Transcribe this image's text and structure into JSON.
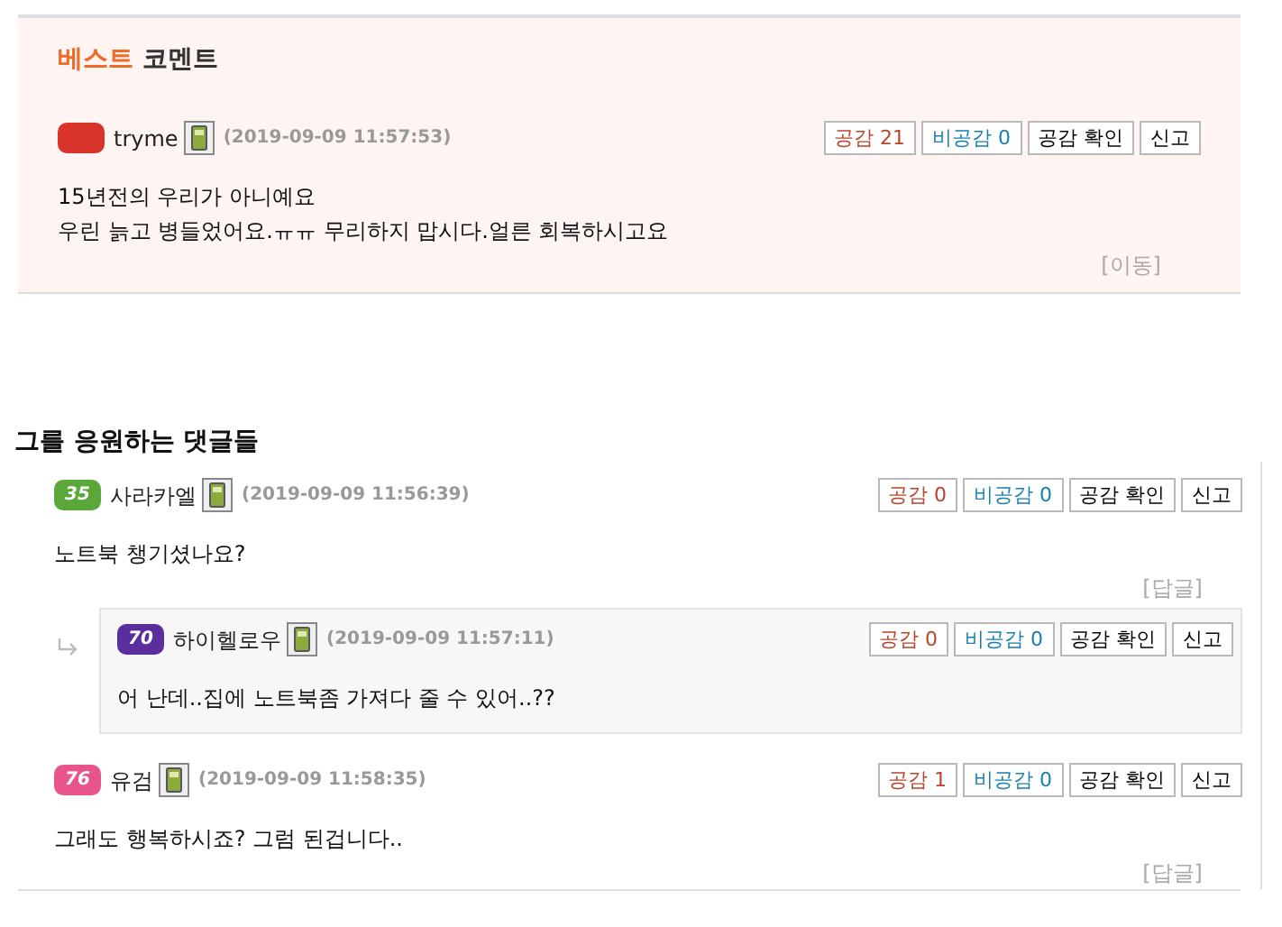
{
  "best": {
    "title_accent": "베스트",
    "title": "코멘트",
    "comments": [
      {
        "user": "tryme",
        "badge": {
          "color": "#d9342b"
        },
        "time": "(2019-09-09 11:57:53)",
        "buttons": [
          {
            "kind": "like",
            "label": "공감 21"
          },
          {
            "kind": "dislike",
            "label": "비공감 0"
          },
          {
            "kind": "plain",
            "label": "공감 확인"
          },
          {
            "kind": "plain",
            "label": "신고"
          }
        ],
        "lines": [
          "15년전의 우리가 아니예요",
          "우린 늙고 병들었어요.ㅠㅠ 무리하지 맙시다.얼른 회복하시고요"
        ],
        "action": "[이동]"
      }
    ]
  },
  "heading": "그를 응원하는 댓글들",
  "comments": [
    {
      "user": "사라카엘",
      "badge": {
        "text": "35",
        "color": "#5aa83a"
      },
      "time": "(2019-09-09 11:56:39)",
      "buttons": [
        {
          "kind": "like",
          "label": "공감 0"
        },
        {
          "kind": "dislike",
          "label": "비공감 0"
        },
        {
          "kind": "plain",
          "label": "공감 확인"
        },
        {
          "kind": "plain",
          "label": "신고"
        }
      ],
      "lines": [
        "노트북 챙기셨나요?"
      ],
      "action": "[답글]",
      "children": [
        {
          "user": "하이헬로우",
          "badge": {
            "text": "70",
            "color": "#5b2e9e"
          },
          "time": "(2019-09-09 11:57:11)",
          "buttons": [
            {
              "kind": "like",
              "label": "공감 0"
            },
            {
              "kind": "dislike",
              "label": "비공감 0"
            },
            {
              "kind": "plain",
              "label": "공감 확인"
            },
            {
              "kind": "plain",
              "label": "신고"
            }
          ],
          "lines": [
            "어 난데..집에 노트북좀 가져다 줄 수 있어..??"
          ]
        }
      ]
    },
    {
      "user": "유검",
      "badge": {
        "text": "76",
        "color": "#e8558a"
      },
      "time": "(2019-09-09 11:58:35)",
      "buttons": [
        {
          "kind": "like",
          "label": "공감 1"
        },
        {
          "kind": "dislike",
          "label": "비공감 0"
        },
        {
          "kind": "plain",
          "label": "공감 확인"
        },
        {
          "kind": "plain",
          "label": "신고"
        }
      ],
      "lines": [
        "그래도 행복하시죠? 그럼 된겁니다.."
      ],
      "action": "[답글]"
    }
  ]
}
